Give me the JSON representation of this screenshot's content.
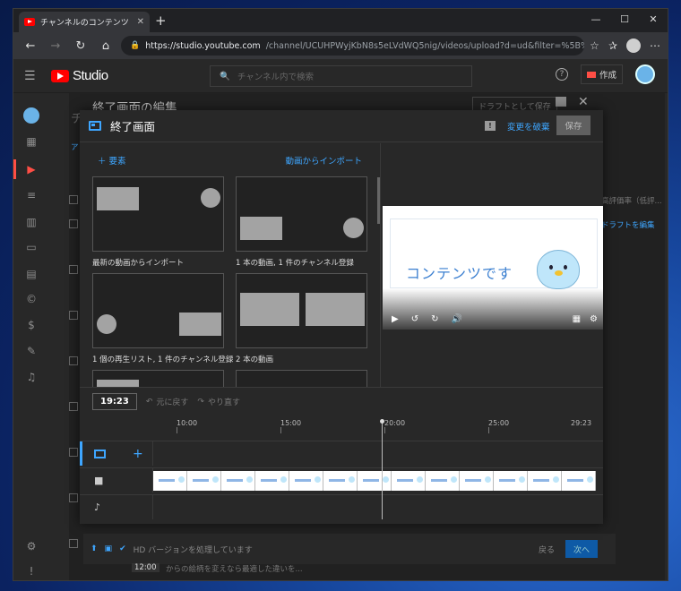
{
  "browser": {
    "tab_title": "チャンネルのコンテンツ - YouTube Stu",
    "new_tab": "+",
    "url_host": "https://studio.youtube.com",
    "url_path": "/channel/UCUHPWyjKbN8s5eLVdWQ5nig/videos/upload?d=ud&filter=%5B%5D&sort=%7B\"colu...",
    "controls": {
      "minimize": "—",
      "maximize": "☐",
      "close": "✕"
    }
  },
  "studio": {
    "logo_text": "Studio",
    "search_placeholder": "チャンネル内で検索",
    "create_label": "作成"
  },
  "background": {
    "editor_title": "終了画面の編集",
    "draft_label": "ドラフトとして保存",
    "partial_heading": "チ",
    "partial_tab": "ア",
    "rating_col": "高評価率（低評...",
    "edit_endscreen_link": "ドラフトを編集",
    "hd_status": "HD バージョンを処理しています",
    "back_label": "戻る",
    "next_label": "次へ",
    "thumb_time": "12:00",
    "row_snippet": "からの絵柄を変えなら最適した違いを..."
  },
  "dialog": {
    "title": "終了画面",
    "feedback_icon": "!",
    "discard_label": "変更を破棄",
    "save_label": "保存",
    "add_element_label": "要素",
    "import_from_video_label": "動画からインポート",
    "templates": [
      {
        "label": "最新の動画からインポート"
      },
      {
        "label": "1 本の動画, 1 件のチャンネル登録"
      },
      {
        "label": "1 個の再生リスト, 1 件のチャンネル登録"
      },
      {
        "label": "2 本の動画"
      }
    ],
    "preview_text": "コンテンツです",
    "current_time": "19:23",
    "undo_label": "元に戻す",
    "redo_label": "やり直す",
    "ruler_ticks": [
      "10:00",
      "15:00",
      "20:00",
      "25:00",
      "29:23"
    ]
  },
  "colors": {
    "accent": "#3ea6ff",
    "youtube_red": "#ff0000",
    "studio_bg": "#282828",
    "dialog_bg": "#282828"
  }
}
